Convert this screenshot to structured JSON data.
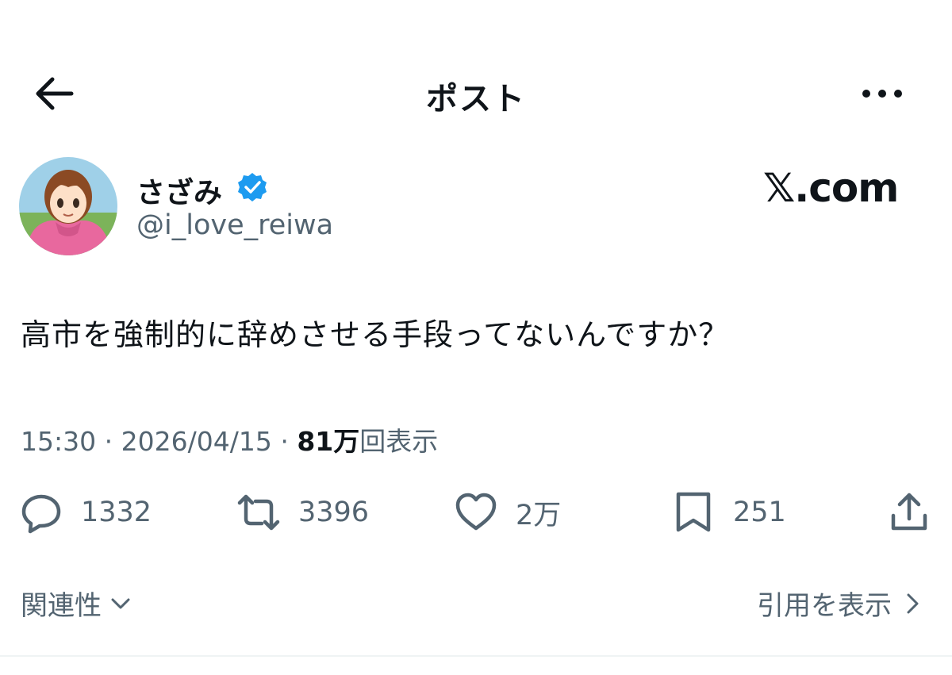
{
  "header": {
    "title": "ポスト"
  },
  "author": {
    "display_name": "さざみ",
    "handle": "@i_love_reiwa"
  },
  "brand": "𝕏.com",
  "tweet": {
    "text": "高市を強制的に辞めさせる手段ってないんですか？"
  },
  "meta": {
    "time": "15:30",
    "separator": "·",
    "date": "2026/04/15",
    "views_count": "81万",
    "views_label": "回表示"
  },
  "actions": {
    "replies": "1332",
    "reposts": "3396",
    "likes": "2万",
    "bookmarks": "251"
  },
  "footer": {
    "related_label": "関連性",
    "quotes_label": "引用を表示"
  },
  "colors": {
    "verified": "#1d9bf0",
    "text": "#0f1419",
    "secondary": "#536471",
    "avatar_hoodie": "#e8689e"
  }
}
